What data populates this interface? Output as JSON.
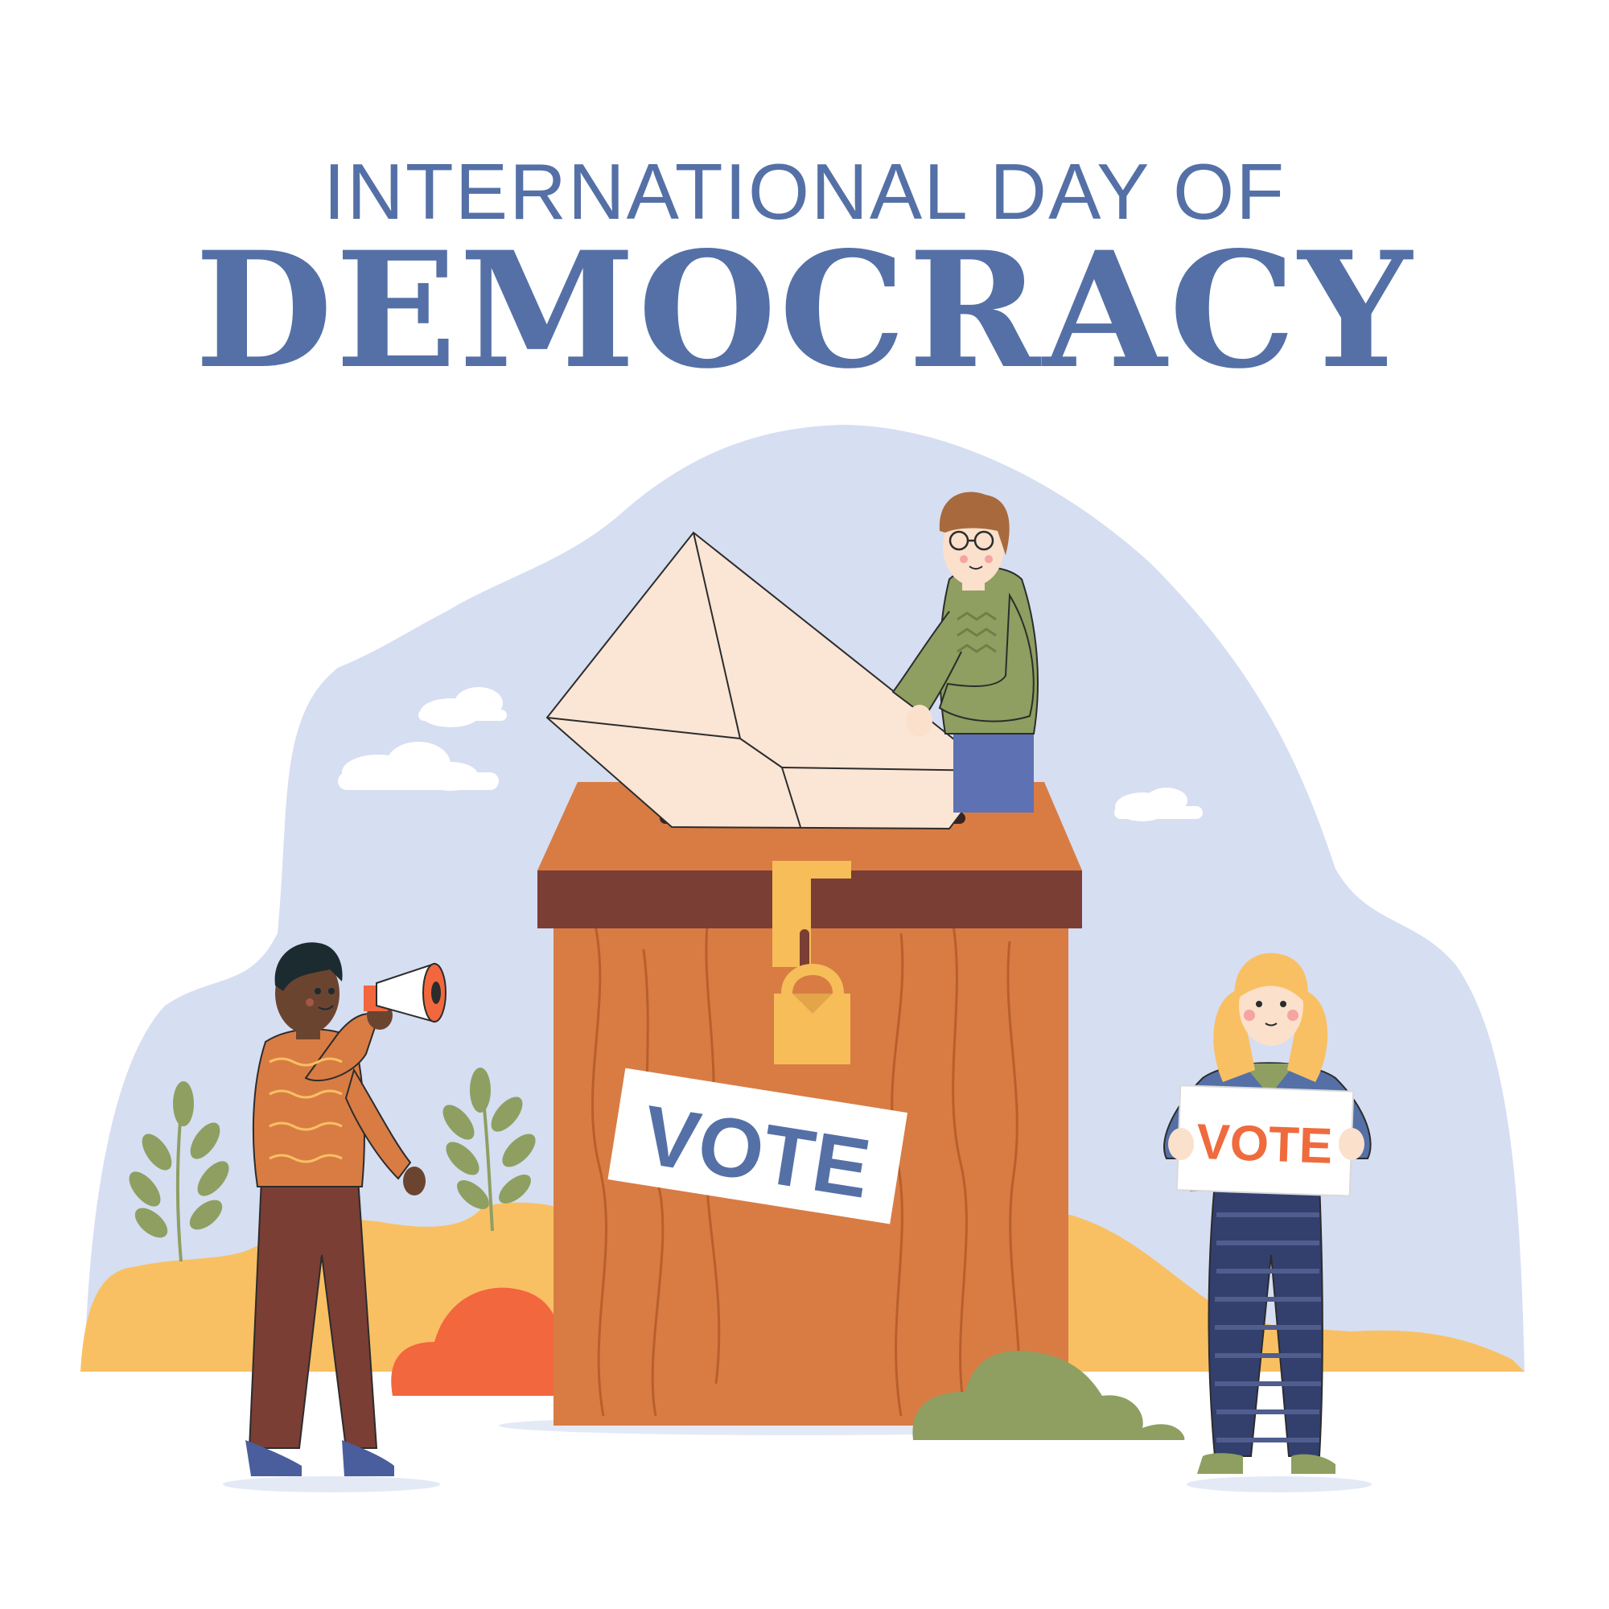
{
  "header": {
    "line1": "INTERNATIONAL DAY OF",
    "line2": "DEMOCRACY"
  },
  "ballot_box": {
    "label": "VOTE"
  },
  "sign": {
    "label": "VOTE"
  },
  "colors": {
    "title_blue": "#5470a6",
    "sky": "#d6def2",
    "hill": "#f9c063",
    "bush_red": "#f2673d",
    "bush_green": "#8e9f61",
    "box": "#d87c44",
    "box_band": "#7a3e35",
    "lock": "#f6bd58",
    "envelope": "#fbe5d5",
    "vote_orange": "#ef6b3d"
  }
}
